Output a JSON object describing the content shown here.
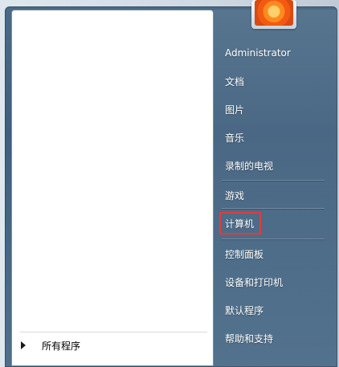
{
  "start_menu": {
    "left_pane": {
      "all_programs_label": "所有程序"
    },
    "right_pane": {
      "items": [
        {
          "label": "Administrator"
        },
        {
          "label": "文档"
        },
        {
          "label": "图片"
        },
        {
          "label": "音乐"
        },
        {
          "label": "录制的电视"
        },
        {
          "label": "游戏"
        },
        {
          "label": "计算机"
        },
        {
          "label": "控制面板"
        },
        {
          "label": "设备和打印机"
        },
        {
          "label": "默认程序"
        },
        {
          "label": "帮助和支持"
        }
      ],
      "highlight_color": "#e53a3a"
    }
  }
}
